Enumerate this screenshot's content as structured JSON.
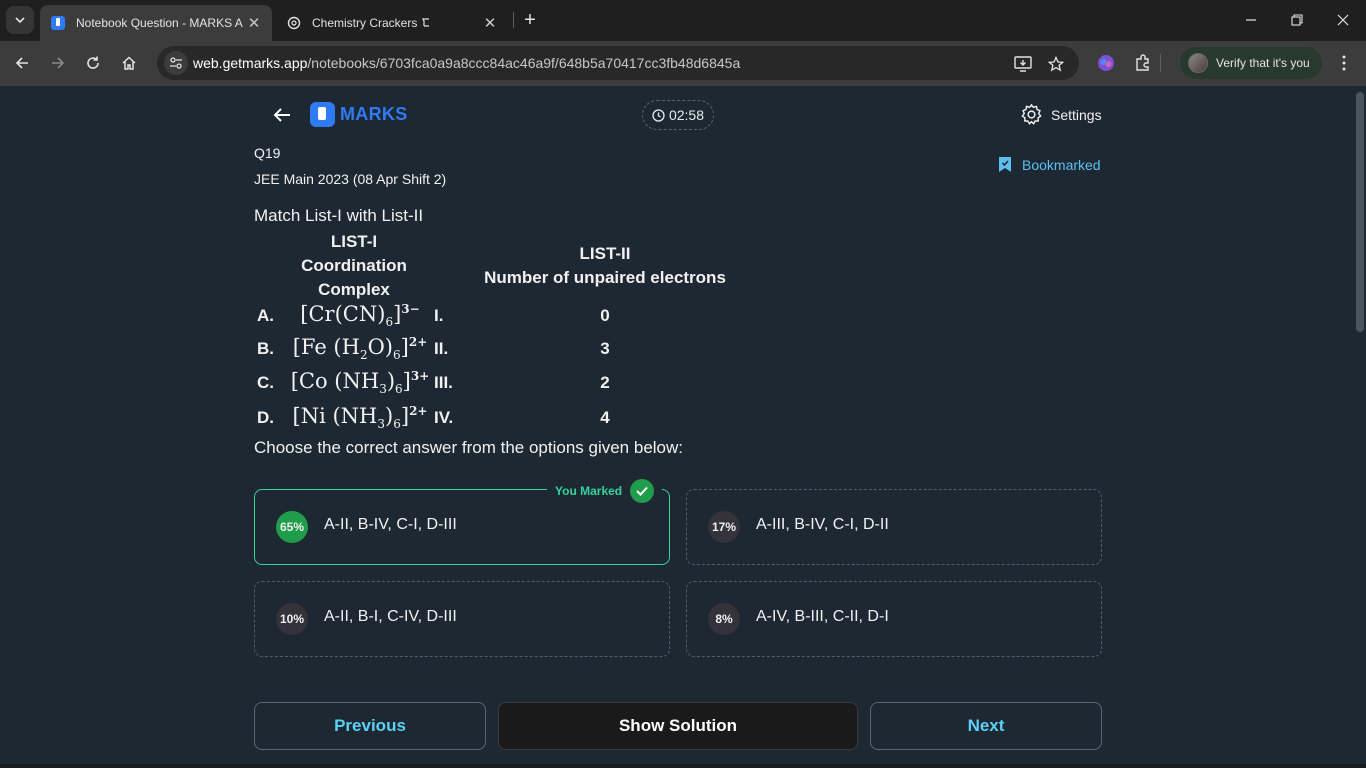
{
  "browser": {
    "tabs": [
      {
        "title": "Notebook Question - MARKS A",
        "active": true
      },
      {
        "title": "Chemistry Crackers"
      }
    ],
    "tab_close_glyph": "✕",
    "new_tab_glyph": "+",
    "url_host": "web.getmarks.app",
    "url_path": "/notebooks/6703fca0a9a8ccc84ac46a9f/648b5a70417cc3fb48d6845a",
    "profile_label": "Verify that it's you"
  },
  "header": {
    "logo_text": "MARKS",
    "timer": "02:58",
    "settings_label": "Settings"
  },
  "question": {
    "number": "Q19",
    "source": "JEE Main 2023 (08 Apr Shift 2)",
    "bookmark_label": "Bookmarked",
    "prompt": "Match List-I with List-II",
    "list1_header": [
      "LIST-I",
      "Coordination",
      "Complex"
    ],
    "list2_header": [
      "LIST-II",
      "Number of unpaired electrons"
    ],
    "rows": [
      {
        "letter": "A.",
        "roman": "I.",
        "value": "0"
      },
      {
        "letter": "B.",
        "roman": "II.",
        "value": "3"
      },
      {
        "letter": "C.",
        "roman": "III.",
        "value": "2"
      },
      {
        "letter": "D.",
        "roman": "IV.",
        "value": "4"
      }
    ],
    "complexes": [
      {
        "parts": [
          "[Cr(CN)",
          "6",
          "]",
          "3−"
        ]
      },
      {
        "parts": [
          "[Fe (H",
          "2",
          "O)",
          "6",
          "]",
          "2+"
        ]
      },
      {
        "parts": [
          "[Co (NH",
          "3",
          ")",
          "6",
          "]",
          "3+"
        ]
      },
      {
        "parts": [
          "[Ni (NH",
          "3",
          ")",
          "6",
          "]",
          "2+"
        ]
      }
    ],
    "instruction": "Choose the correct answer from the options given below:"
  },
  "options": [
    {
      "percent": "65%",
      "text": "A-II, B-IV, C-I, D-III",
      "marked": true
    },
    {
      "percent": "17%",
      "text": "A-III, B-IV, C-I, D-II",
      "marked": false
    },
    {
      "percent": "10%",
      "text": "A-II, B-I, C-IV, D-III",
      "marked": false
    },
    {
      "percent": "8%",
      "text": "A-IV, B-III, C-II, D-I",
      "marked": false
    }
  ],
  "marked_label": "You Marked",
  "buttons": {
    "previous": "Previous",
    "show_solution": "Show Solution",
    "next": "Next"
  },
  "colors": {
    "page_bg": "#1e2833",
    "brand_blue": "#2f7bf5",
    "accent_cyan": "#5bd1f5",
    "marked_green": "#35d399",
    "percent_green": "#1f9d4a"
  }
}
